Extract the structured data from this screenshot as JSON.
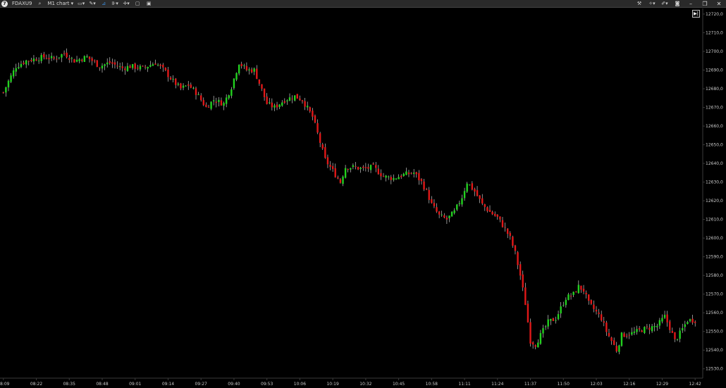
{
  "toolbar": {
    "instrument": "FDAXU9",
    "timeframe": "M1 chart",
    "left_icons": [
      "search-icon",
      "monitor-icon",
      "pencil-icon",
      "chart-type-icon",
      "indicator-icon",
      "crosshair-icon",
      "window-icon",
      "save-icon"
    ],
    "right_icons": [
      "tools-icon",
      "magic-icon",
      "draw-icon",
      "camera-icon",
      "minimize-icon",
      "restore-icon",
      "close-icon"
    ]
  },
  "colors": {
    "background": "#000000",
    "up_candle": "#22d11f",
    "down_candle": "#e01818",
    "wick": "#e8e8e8",
    "axis_text": "#c8c8c8",
    "axis_line": "#3a3a3a",
    "toolbar_bg": "#2a2a2a",
    "accent": "#3b8fe3"
  },
  "chart_data": {
    "type": "candlestick",
    "instrument": "FDAXU9",
    "interval": "M1",
    "y_axis": {
      "min": 12525,
      "max": 12723,
      "ticks": [
        "12720,0",
        "12710,0",
        "12700,0",
        "12690,0",
        "12680,0",
        "12670,0",
        "12660,0",
        "12650,0",
        "12640,0",
        "12630,0",
        "12620,0",
        "12610,0",
        "12600,0",
        "12590,0",
        "12580,0",
        "12570,0",
        "12560,0",
        "12550,0",
        "12540,0",
        "12530,0"
      ],
      "tick_values": [
        12720,
        12710,
        12700,
        12690,
        12680,
        12670,
        12660,
        12650,
        12640,
        12630,
        12620,
        12610,
        12600,
        12590,
        12580,
        12570,
        12560,
        12550,
        12540,
        12530
      ]
    },
    "x_axis": {
      "ticks": [
        "08:09",
        "08:22",
        "08:35",
        "08:48",
        "09:01",
        "09:14",
        "09:27",
        "09:40",
        "09:53",
        "10:06",
        "10:19",
        "10:32",
        "10:45",
        "10:58",
        "11:11",
        "11:24",
        "11:37",
        "11:50",
        "12:03",
        "12:16",
        "12:29",
        "12:42"
      ],
      "start_time": "08:09",
      "end_time": "12:42",
      "bars": 274
    },
    "close_path": [
      [
        0,
        12678
      ],
      [
        2,
        12684
      ],
      [
        5,
        12692
      ],
      [
        9,
        12695
      ],
      [
        16,
        12697
      ],
      [
        20,
        12696
      ],
      [
        24,
        12699
      ],
      [
        28,
        12695
      ],
      [
        33,
        12697
      ],
      [
        38,
        12692
      ],
      [
        42,
        12694
      ],
      [
        47,
        12691
      ],
      [
        50,
        12692
      ],
      [
        55,
        12691
      ],
      [
        60,
        12694
      ],
      [
        64,
        12689
      ],
      [
        67,
        12684
      ],
      [
        70,
        12680
      ],
      [
        73,
        12682
      ],
      [
        76,
        12678
      ],
      [
        80,
        12670
      ],
      [
        83,
        12674
      ],
      [
        87,
        12672
      ],
      [
        90,
        12681
      ],
      [
        93,
        12694
      ],
      [
        96,
        12690
      ],
      [
        99,
        12690
      ],
      [
        101,
        12683
      ],
      [
        104,
        12672
      ],
      [
        107,
        12670
      ],
      [
        111,
        12674
      ],
      [
        115,
        12676
      ],
      [
        118,
        12674
      ],
      [
        122,
        12665
      ],
      [
        124,
        12656
      ],
      [
        127,
        12642
      ],
      [
        130,
        12636
      ],
      [
        133,
        12630
      ],
      [
        135,
        12638
      ],
      [
        138,
        12638
      ],
      [
        142,
        12637
      ],
      [
        146,
        12638
      ],
      [
        150,
        12633
      ],
      [
        154,
        12632
      ],
      [
        158,
        12634
      ],
      [
        162,
        12635
      ],
      [
        165,
        12630
      ],
      [
        167,
        12625
      ],
      [
        169,
        12618
      ],
      [
        172,
        12612
      ],
      [
        175,
        12610
      ],
      [
        178,
        12614
      ],
      [
        181,
        12622
      ],
      [
        183,
        12630
      ],
      [
        186,
        12625
      ],
      [
        189,
        12618
      ],
      [
        192,
        12614
      ],
      [
        195,
        12611
      ],
      [
        198,
        12605
      ],
      [
        200,
        12600
      ],
      [
        202,
        12592
      ],
      [
        204,
        12580
      ],
      [
        206,
        12565
      ],
      [
        208,
        12545
      ],
      [
        210,
        12543
      ],
      [
        212,
        12548
      ],
      [
        215,
        12555
      ],
      [
        218,
        12557
      ],
      [
        222,
        12568
      ],
      [
        225,
        12570
      ],
      [
        227,
        12574
      ],
      [
        229,
        12572
      ],
      [
        231,
        12565
      ],
      [
        233,
        12562
      ],
      [
        236,
        12557
      ],
      [
        238,
        12550
      ],
      [
        240,
        12545
      ],
      [
        242,
        12540
      ],
      [
        244,
        12548
      ],
      [
        248,
        12549
      ],
      [
        252,
        12551
      ],
      [
        255,
        12552
      ],
      [
        258,
        12553
      ],
      [
        261,
        12558
      ],
      [
        263,
        12552
      ],
      [
        265,
        12545
      ],
      [
        267,
        12549
      ],
      [
        270,
        12556
      ],
      [
        273,
        12556
      ]
    ]
  }
}
